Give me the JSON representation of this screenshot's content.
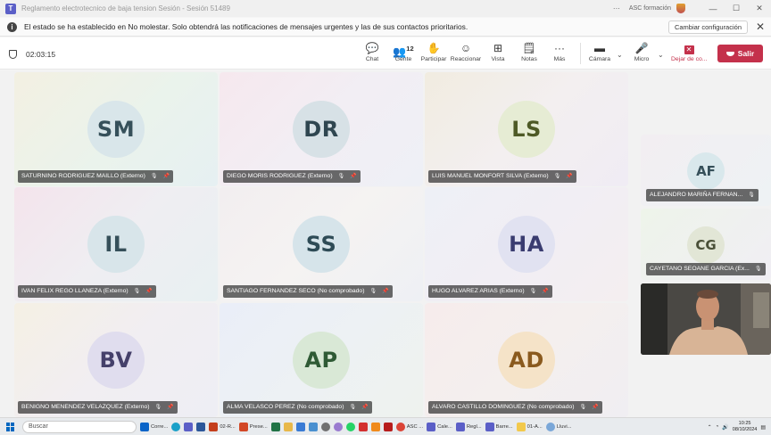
{
  "window": {
    "title": "Reglamento electrotecnico de baja tension Sesión - Sesión 51489",
    "account": "ASC formación",
    "controls": [
      "···",
      "—",
      "☐",
      "✕"
    ]
  },
  "notification": {
    "text": "El estado se ha establecido en No molestar. Solo obtendrá las notificaciones de mensajes urgentes y las de sus contactos prioritarios.",
    "button": "Cambiar configuración",
    "close": "✕"
  },
  "toolbar": {
    "timer": "02:03:15",
    "chat": "Chat",
    "people": "Gente",
    "people_count": "12",
    "raise": "Participar",
    "react": "Reaccionar",
    "view": "Vista",
    "notes": "Notas",
    "more": "Más",
    "camera": "Cámara",
    "mic": "Micro",
    "leave_share": "Dejar de co...",
    "leave": "Salir",
    "glyphs": {
      "chat": "💬",
      "people": "👥",
      "raise": "✋",
      "react": "☺",
      "view": "⊞",
      "notes": "🗒",
      "more": "···",
      "camera": "▬",
      "mic": "🎤",
      "leave_share": "✕",
      "caret": "⌄",
      "tag_mic": "🎙",
      "tag_pin": "📌"
    }
  },
  "participants": [
    {
      "initials": "SM",
      "name": "SATURNINO RODRIGUEZ MAILLO (Externo)"
    },
    {
      "initials": "DR",
      "name": "DIEGO MORIS RODRIGUEZ (Externo)"
    },
    {
      "initials": "LS",
      "name": "LUIS MANUEL MONFORT SILVA (Externo)"
    },
    {
      "initials": "IL",
      "name": "IVAN FELIX REGO LLANEZA (Externo)"
    },
    {
      "initials": "SS",
      "name": "SANTIAGO FERNANDEZ SECO (No comprobado)"
    },
    {
      "initials": "HA",
      "name": "HUGO ALVAREZ ARIAS (Externo)"
    },
    {
      "initials": "BV",
      "name": "BENIGNO MENENDEZ VELAZQUEZ (Externo)"
    },
    {
      "initials": "AP",
      "name": "ALMA VELASCO PEREZ (No comprobado)"
    },
    {
      "initials": "AD",
      "name": "ALVARO CASTILLO DOMINGUEZ (No comprobado)"
    }
  ],
  "side_participants": [
    {
      "initials": "AF",
      "name": "ALEJANDRO MARIÑA FERNAN..."
    },
    {
      "initials": "CG",
      "name": "CAYETANO SEOANE GARCIA (Ex..."
    }
  ],
  "taskbar": {
    "search": "Buscar",
    "apps": [
      "Corre...",
      "02-R...",
      "Prese...",
      "ASC ...",
      "Cale...",
      "Regl...",
      "Barre...",
      "01-A..."
    ],
    "weather": "Lluvi...",
    "time": "10:25",
    "date": "08/10/2024"
  },
  "colors": {
    "leave_red": "#c4314b",
    "accent": "#5b5fc7"
  }
}
